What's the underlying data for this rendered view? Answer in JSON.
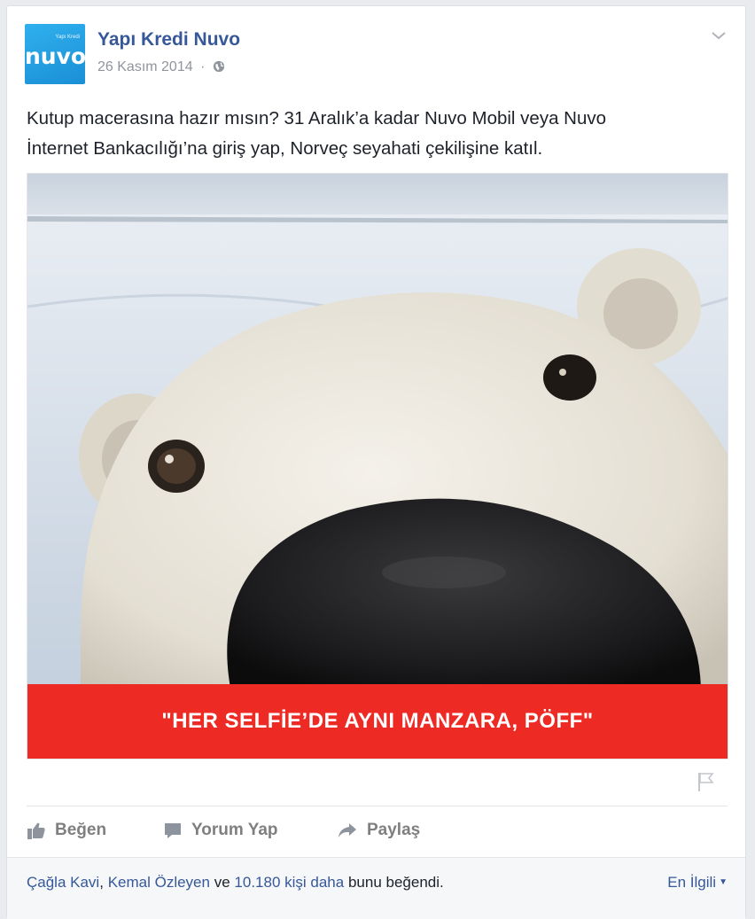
{
  "post": {
    "page_name": "Yapı Kredi Nuvo",
    "date": "26 Kasım 2014",
    "separator": "·",
    "privacy_icon": "globe-icon",
    "text_line1": "Kutup macerasına hazır mısın? 31 Aralık’a kadar Nuvo Mobil veya Nuvo",
    "text_line2": "İnternet Bankacılığı’na giriş yap, Norveç seyahati çekilişine katıl.",
    "avatar": {
      "logo_text": "nuvo",
      "small_text": "Yapı Kredi"
    },
    "image": {
      "banner_text": "\"HER SELFİE’DE AYNI MANZARA, PÖFF\""
    }
  },
  "actions": {
    "like": "Beğen",
    "comment": "Yorum Yap",
    "share": "Paylaş"
  },
  "likes": {
    "name1": "Çağla Kavi",
    "comma": ",",
    "name2": "Kemal Özleyen",
    "and": "ve",
    "others": "10.180 kişi daha",
    "suffix": "bunu beğendi.",
    "sort": "En İlgili"
  },
  "colors": {
    "link": "#365899",
    "banner": "#ee2a24",
    "avatar": "#1b8fd6",
    "action_gray": "#7f7f7f"
  }
}
